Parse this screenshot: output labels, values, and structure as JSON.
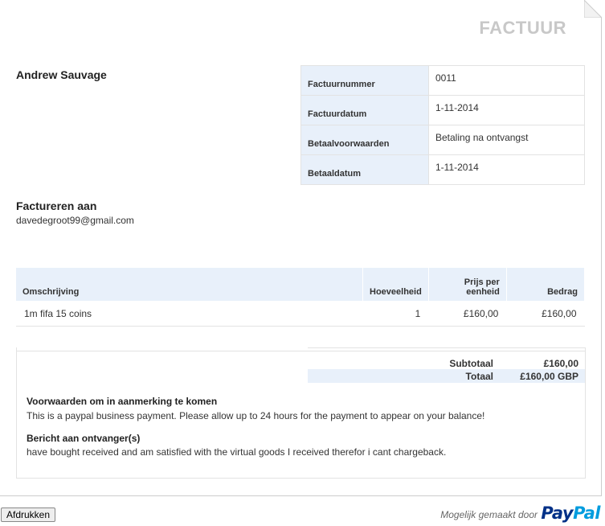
{
  "invoice": {
    "title": "FACTUUR",
    "from_name": "Andrew Sauvage",
    "meta": [
      {
        "label": "Factuurnummer",
        "value": "0011"
      },
      {
        "label": "Factuurdatum",
        "value": "1-11-2014"
      },
      {
        "label": "Betaalvoorwaarden",
        "value": "Betaling na ontvangst"
      },
      {
        "label": "Betaaldatum",
        "value": "1-11-2014"
      }
    ],
    "bill_to": {
      "heading": "Factureren aan",
      "email": "davedegroot99@gmail.com"
    },
    "items": {
      "headers": {
        "description": "Omschrijving",
        "quantity": "Hoeveelheid",
        "unit_price": "Prijs per eenheid",
        "amount": "Bedrag"
      },
      "rows": [
        {
          "description": "1m fifa 15 coins",
          "quantity": "1",
          "unit_price": "£160,00",
          "amount": "£160,00"
        }
      ]
    },
    "totals": {
      "subtotal_label": "Subtotaal",
      "subtotal_value": "£160,00",
      "total_label": "Totaal",
      "total_value": "£160,00 GBP"
    },
    "terms": {
      "heading": "Voorwaarden om in aanmerking te komen",
      "text": "This is a paypal business payment. Please allow up to 24 hours for the payment to appear on your balance!"
    },
    "message": {
      "heading": "Bericht aan ontvanger(s)",
      "text": "have bought received and am satisfied with the virtual goods I received therefor i cant chargeback."
    }
  },
  "footer": {
    "print_label": "Afdrukken",
    "powered_by": "Mogelijk gemaakt door",
    "logo_part1": "Pay",
    "logo_part2": "Pal"
  },
  "colors": {
    "header_bg": "#e8f0fa",
    "title_gray": "#c8c8c8",
    "paypal_dark": "#003087",
    "paypal_light": "#009cde"
  }
}
